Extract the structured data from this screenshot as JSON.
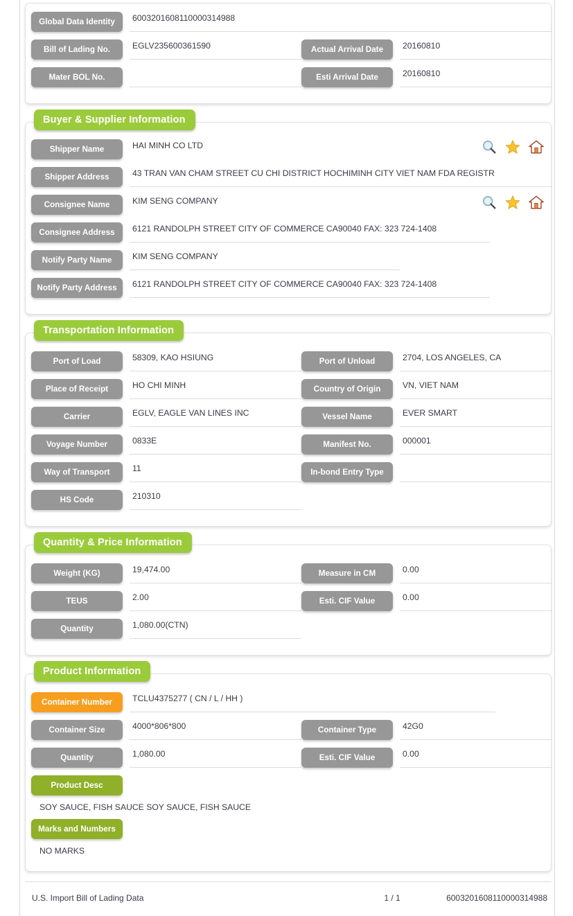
{
  "identity_card": {
    "rows": [
      {
        "label": "Global Data Identity",
        "value": "6003201608110000314988",
        "wide": true
      },
      {
        "label": "Bill of Lading No.",
        "value": "EGLV235600361590",
        "label2": "Actual Arrival Date",
        "value2": "20160810"
      },
      {
        "label": "Mater BOL No.",
        "value": "",
        "label2": "Esti Arrival Date",
        "value2": "20160810"
      }
    ]
  },
  "buyer_supplier": {
    "title": "Buyer & Supplier Information",
    "shipper_name_label": "Shipper Name",
    "shipper_name_value": "HAI MINH CO LTD",
    "shipper_address_label": "Shipper Address",
    "shipper_address_value": "43 TRAN VAN CHAM STREET CU CHI DISTRICT HOCHIMINH CITY VIET NAM FDA REGISTR",
    "consignee_name_label": "Consignee Name",
    "consignee_name_value": "KIM SENG COMPANY",
    "consignee_address_label": "Consignee Address",
    "consignee_address_value": "6121 RANDOLPH STREET CITY OF COMMERCE CA90040 FAX: 323 724-1408",
    "notify_name_label": "Notify Party Name",
    "notify_name_value": "KIM SENG COMPANY",
    "notify_address_label": "Notify Party Address",
    "notify_address_value": "6121 RANDOLPH STREET CITY OF COMMERCE CA90040 FAX: 323 724-1408",
    "icons": [
      "search-icon",
      "star-icon",
      "home-icon"
    ]
  },
  "transportation": {
    "title": "Transportation Information",
    "rows": [
      {
        "label": "Port of Load",
        "value": "58309, KAO HSIUNG",
        "label2": "Port of Unload",
        "value2": "2704, LOS ANGELES, CA"
      },
      {
        "label": "Place of Receipt",
        "value": "HO CHI MINH",
        "label2": "Country of Origin",
        "value2": "VN, VIET NAM"
      },
      {
        "label": "Carrier",
        "value": "EGLV, EAGLE VAN LINES INC",
        "label2": "Vessel Name",
        "value2": "EVER SMART"
      },
      {
        "label": "Voyage Number",
        "value": "0833E",
        "label2": "Manifest No.",
        "value2": "000001"
      },
      {
        "label": "Way of Transport",
        "value": "11",
        "label2": "In-bond Entry Type",
        "value2": ""
      },
      {
        "label": "HS Code",
        "value": "210310",
        "label2": "",
        "value2": ""
      }
    ]
  },
  "quantity_price": {
    "title": "Quantity & Price Information",
    "rows": [
      {
        "label": "Weight (KG)",
        "value": "19,474.00",
        "label2": "Measure in CM",
        "value2": "0.00"
      },
      {
        "label": "TEUS",
        "value": "2.00",
        "label2": "Esti. CIF Value",
        "value2": "0.00"
      },
      {
        "label": "Quantity",
        "value": "1,080.00(CTN)",
        "label2": "",
        "value2": ""
      }
    ]
  },
  "product": {
    "title": "Product Information",
    "container_number_label": "Container Number",
    "container_number_value": "TCLU4375277 ( CN / L / HH )",
    "rows": [
      {
        "label": "Container Size",
        "value": "4000*806*800",
        "label2": "Container Type",
        "value2": "42G0"
      },
      {
        "label": "Quantity",
        "value": "1,080.00",
        "label2": "Esti. CIF Value",
        "value2": "0.00"
      }
    ],
    "product_desc_label": "Product Desc",
    "product_desc_value": "SOY SAUCE, FISH SAUCE SOY SAUCE, FISH SAUCE",
    "marks_label": "Marks and Numbers",
    "marks_value": "NO MARKS"
  },
  "footer": {
    "left": "U.S. Import Bill of Lading Data",
    "center": "1 / 1",
    "right": "6003201608110000314988"
  },
  "colors": {
    "section_green": "#9bcb3b",
    "pill_gray": "#979797",
    "pill_orange": "#f79e1f",
    "pill_green": "#8fb028"
  }
}
